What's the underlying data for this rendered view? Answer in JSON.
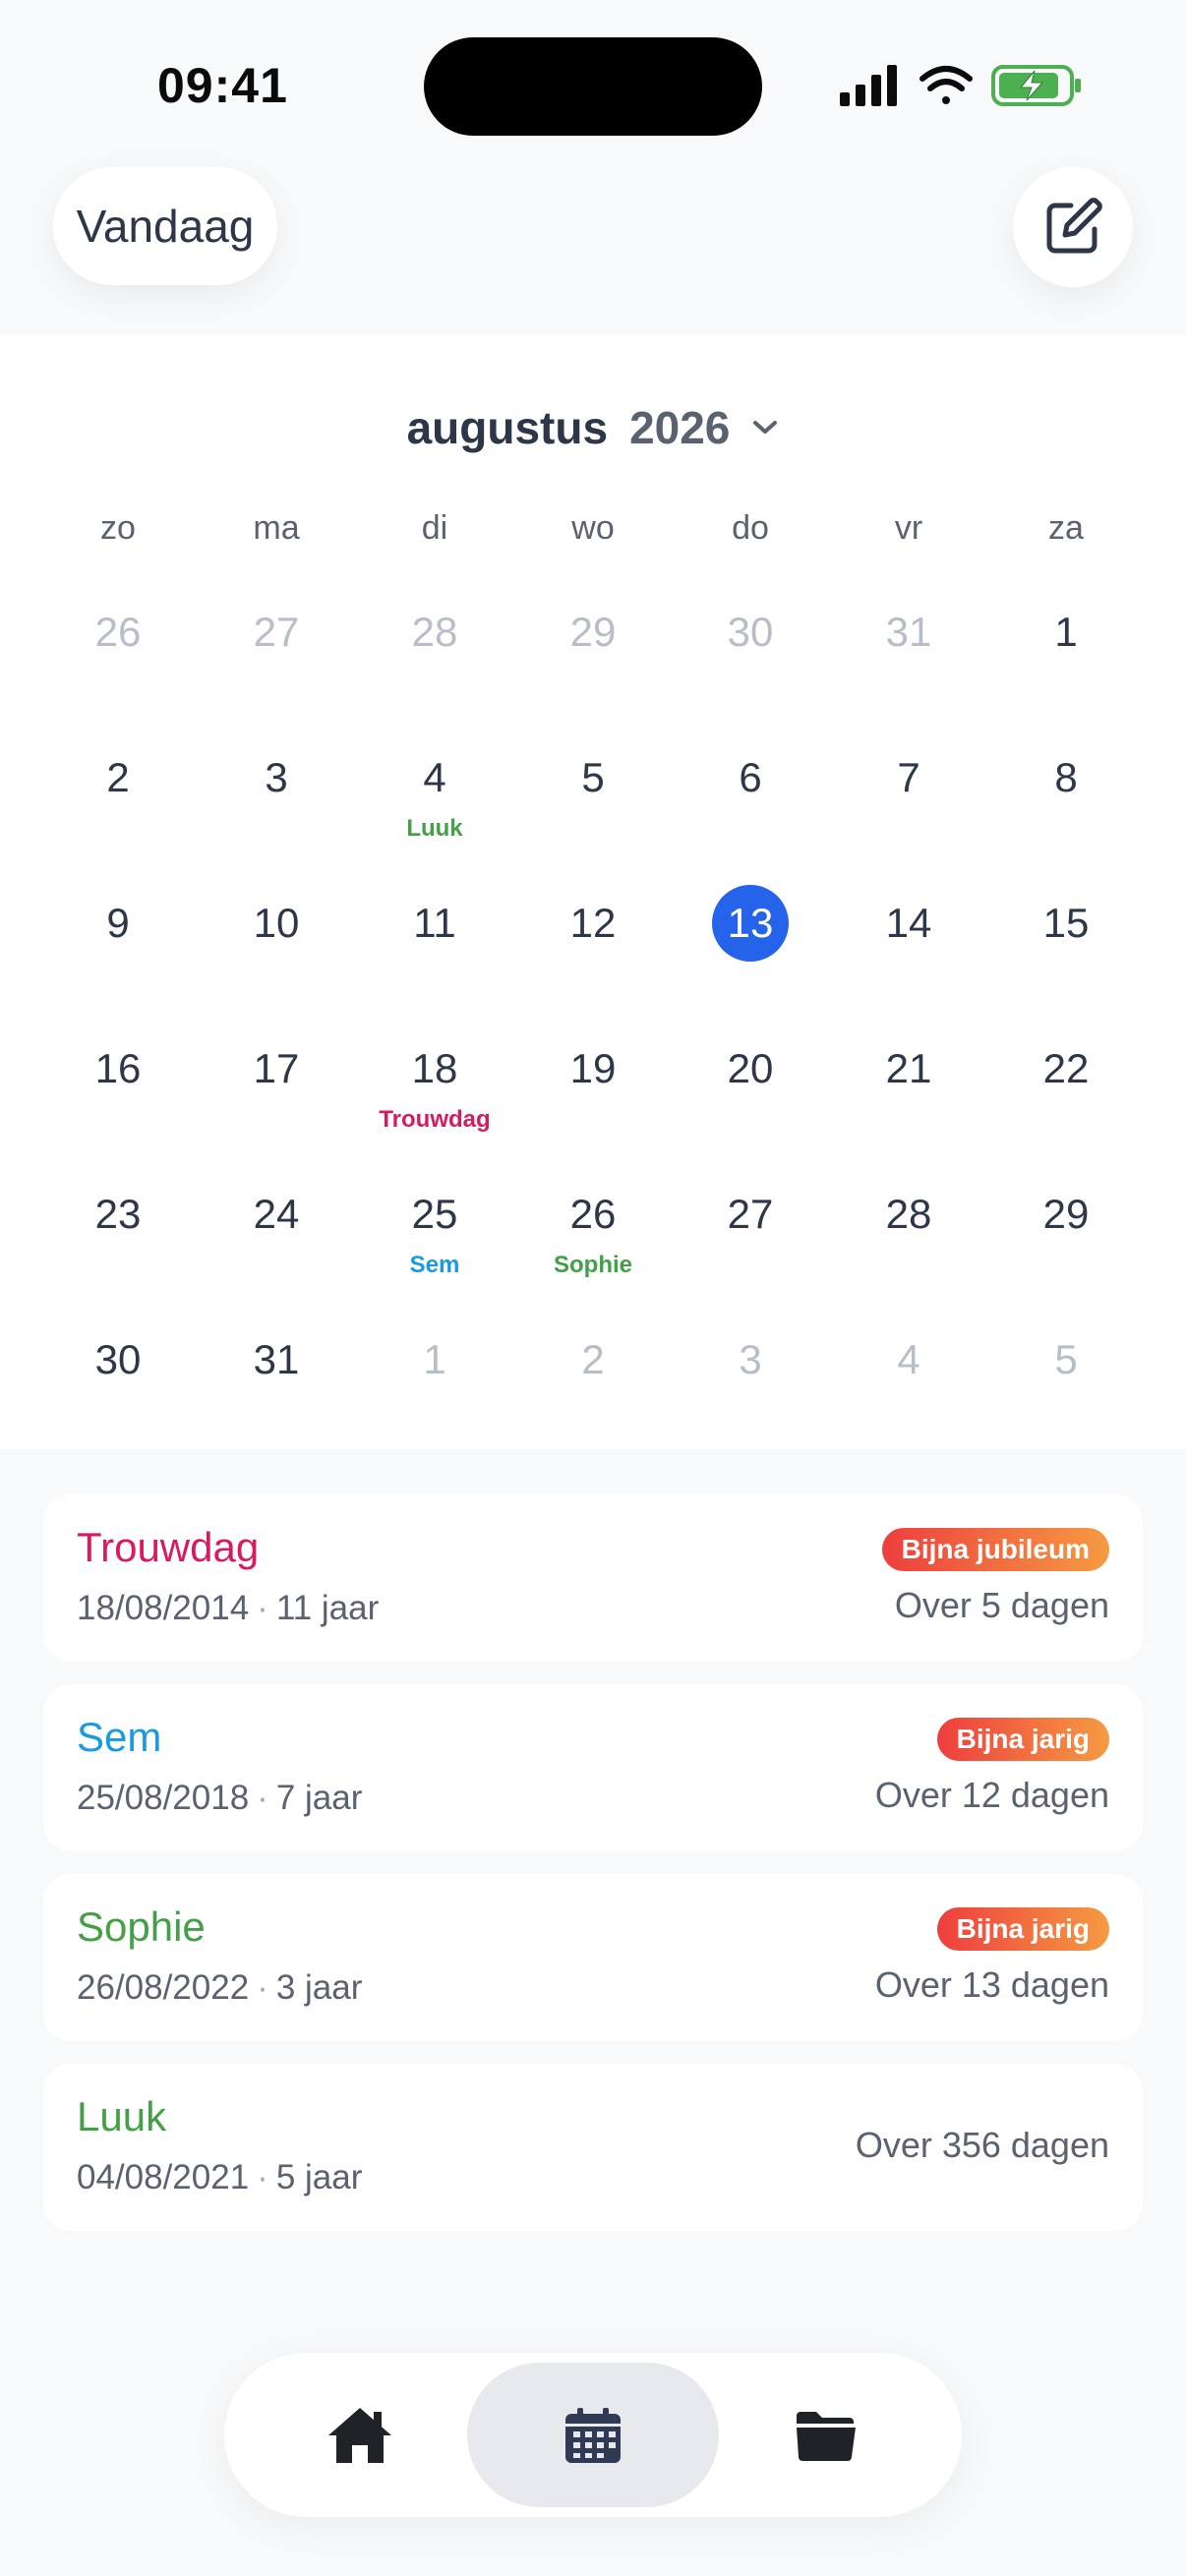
{
  "status_bar": {
    "time": "09:41"
  },
  "header": {
    "today_label": "Vandaag"
  },
  "calendar": {
    "month": "augustus",
    "year": "2026",
    "weekdays": [
      "zo",
      "ma",
      "di",
      "wo",
      "do",
      "vr",
      "za"
    ],
    "weeks": [
      [
        {
          "n": "26",
          "muted": true
        },
        {
          "n": "27",
          "muted": true
        },
        {
          "n": "28",
          "muted": true
        },
        {
          "n": "29",
          "muted": true
        },
        {
          "n": "30",
          "muted": true
        },
        {
          "n": "31",
          "muted": true
        },
        {
          "n": "1"
        }
      ],
      [
        {
          "n": "2"
        },
        {
          "n": "3"
        },
        {
          "n": "4",
          "event": "Luuk",
          "color": "#43a047"
        },
        {
          "n": "5"
        },
        {
          "n": "6"
        },
        {
          "n": "7"
        },
        {
          "n": "8"
        }
      ],
      [
        {
          "n": "9"
        },
        {
          "n": "10"
        },
        {
          "n": "11"
        },
        {
          "n": "12"
        },
        {
          "n": "13",
          "today": true
        },
        {
          "n": "14"
        },
        {
          "n": "15"
        }
      ],
      [
        {
          "n": "16"
        },
        {
          "n": "17"
        },
        {
          "n": "18",
          "event": "Trouwdag",
          "color": "#d81b60"
        },
        {
          "n": "19"
        },
        {
          "n": "20"
        },
        {
          "n": "21"
        },
        {
          "n": "22"
        }
      ],
      [
        {
          "n": "23"
        },
        {
          "n": "24"
        },
        {
          "n": "25",
          "event": "Sem",
          "color": "#1a9be0"
        },
        {
          "n": "26",
          "event": "Sophie",
          "color": "#43a047"
        },
        {
          "n": "27"
        },
        {
          "n": "28"
        },
        {
          "n": "29"
        }
      ],
      [
        {
          "n": "30"
        },
        {
          "n": "31"
        },
        {
          "n": "1",
          "muted": true
        },
        {
          "n": "2",
          "muted": true
        },
        {
          "n": "3",
          "muted": true
        },
        {
          "n": "4",
          "muted": true
        },
        {
          "n": "5",
          "muted": true
        }
      ]
    ]
  },
  "events": [
    {
      "name": "Trouwdag",
      "color": "#d81b60",
      "date": "18/08/2014",
      "age": "11 jaar",
      "badge": "Bijna jubileum",
      "when": "Over 5 dagen"
    },
    {
      "name": "Sem",
      "color": "#1a9be0",
      "date": "25/08/2018",
      "age": "7 jaar",
      "badge": "Bijna jarig",
      "when": "Over 12 dagen"
    },
    {
      "name": "Sophie",
      "color": "#43a047",
      "date": "26/08/2022",
      "age": "3 jaar",
      "badge": "Bijna jarig",
      "when": "Over 13 dagen"
    },
    {
      "name": "Luuk",
      "color": "#43a047",
      "date": "04/08/2021",
      "age": "5 jaar",
      "badge": "",
      "when": "Over 356 dagen"
    }
  ],
  "tabbar": {
    "tabs": [
      {
        "icon": "home-icon",
        "active": false
      },
      {
        "icon": "calendar-icon",
        "active": true
      },
      {
        "icon": "folder-icon",
        "active": false
      }
    ]
  }
}
